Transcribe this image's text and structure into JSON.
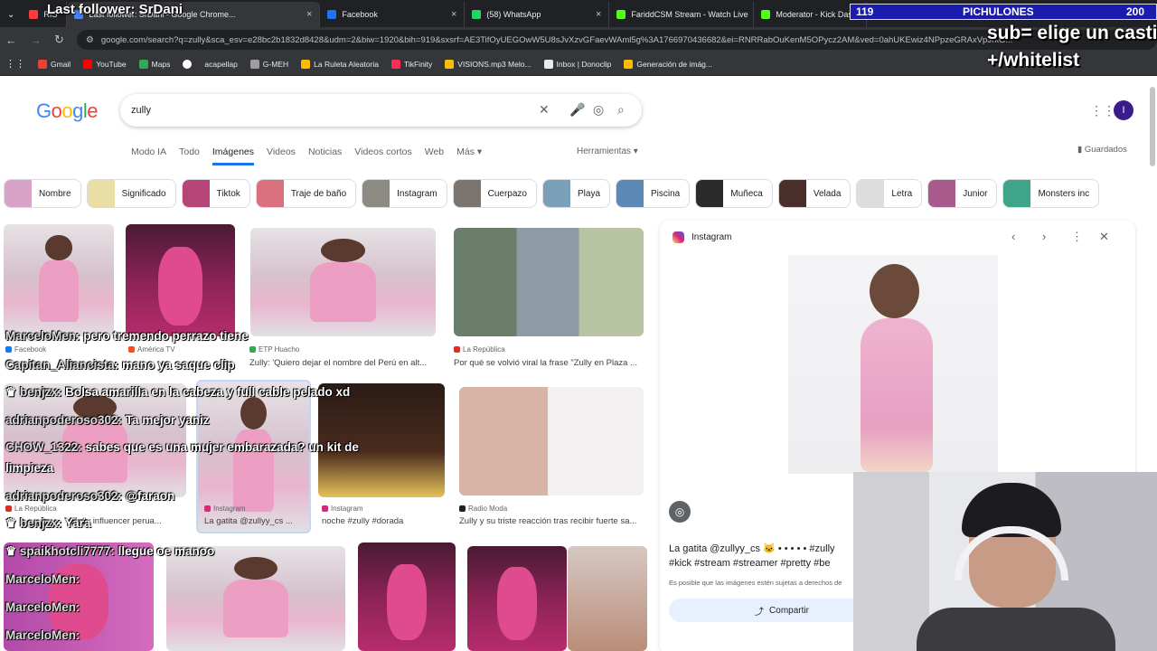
{
  "browser": {
    "tabs": [
      {
        "label": "RIS",
        "color": "#ff3b3b"
      },
      {
        "label": "Last follower: SrDani - Google Chrome...",
        "color": "#4285f4"
      },
      {
        "label": "Facebook",
        "color": "#1877f2"
      },
      {
        "label": "(58) WhatsApp",
        "color": "#25d366"
      },
      {
        "label": "FariddCSM Stream - Watch Live",
        "color": "#53fc18"
      },
      {
        "label": "Moderator - Kick Dashboard",
        "color": "#53fc18"
      }
    ],
    "url": "google.com/search?q=zully&sca_esv=e28bc2b1832d8428&udm=2&biw=1920&bih=919&sxsrf=AE3TifOyUEGOwW5U8sJvXzvGFaevWAml5g%3A1766970436682&ei=RNRRabOuKenM5OPycz2AM&ved=0ahUKEwiz4NPpzeGRAxVpJrkG...",
    "bookmarks": [
      {
        "label": "Gmail",
        "color": "#ea4335"
      },
      {
        "label": "YouTube",
        "color": "#ff0000"
      },
      {
        "label": "Maps",
        "color": "#34a853"
      },
      {
        "label": "",
        "color": "#ffffff"
      },
      {
        "label": "acapellap",
        "color": "#9e9e9e"
      },
      {
        "label": "G-MEH",
        "color": "#9e9e9e"
      },
      {
        "label": "La Ruleta Aleatoria",
        "color": "#fbbc05"
      },
      {
        "label": "TikFinity",
        "color": "#ff2d55"
      },
      {
        "label": "VISIONS.mp3 Melo...",
        "color": "#fbbc05"
      },
      {
        "label": "Inbox | Donoclip",
        "color": "#e8eaed"
      },
      {
        "label": "Generación de imág...",
        "color": "#fbbc05"
      }
    ]
  },
  "google": {
    "logo": "Google",
    "query": "zully",
    "avatar_letter": "I",
    "nav": [
      "Modo IA",
      "Todo",
      "Imágenes",
      "Videos",
      "Noticias",
      "Videos cortos",
      "Web",
      "Más ▾"
    ],
    "tools": "Herramientas ▾",
    "saved": "Guardados",
    "chips": [
      {
        "label": "Nombre",
        "color": "#d8a3c6"
      },
      {
        "label": "Significado",
        "color": "#e9dfa6"
      },
      {
        "label": "Tiktok",
        "color": "#b54577"
      },
      {
        "label": "Traje de baño",
        "color": "#d9707e"
      },
      {
        "label": "Instagram",
        "color": "#8c8a83"
      },
      {
        "label": "Cuerpazo",
        "color": "#7c746e"
      },
      {
        "label": "Playa",
        "color": "#7aa0b8"
      },
      {
        "label": "Piscina",
        "color": "#5b88b5"
      },
      {
        "label": "Muñeca",
        "color": "#2b2b2b"
      },
      {
        "label": "Velada",
        "color": "#4a2e2a"
      },
      {
        "label": "Letra",
        "color": "#dddddd"
      },
      {
        "label": "Junior",
        "color": "#a85a8c"
      },
      {
        "label": "Monsters inc",
        "color": "#3fa58a"
      }
    ],
    "results": [
      {
        "source": "Facebook",
        "caption": "",
        "color": "#1877f2"
      },
      {
        "source": "América TV",
        "caption": "",
        "color": "#f4511e"
      },
      {
        "source": "ETP Huacho",
        "caption": "Zully: 'Quiero dejar el nombre del Perú en alt...",
        "color": "#34a853"
      },
      {
        "source": "La República",
        "caption": "Por qué se volvió viral la frase \"Zully en Plaza ...",
        "color": "#d93025"
      },
      {
        "source": "La República",
        "caption": "Zully influencer perua...",
        "color": "#d93025"
      },
      {
        "source": "Instagram",
        "caption": "La gatita @zullyy_cs ...",
        "color": "#d62976"
      },
      {
        "source": "Instagram",
        "caption": "noche #zully #dorada",
        "color": "#d62976"
      },
      {
        "source": "Radio Moda",
        "caption": "Zully y su triste reacción tras recibir fuerte sa...",
        "color": "#202124"
      }
    ]
  },
  "panel": {
    "source": "Instagram",
    "title": "La gatita @zullyy_cs 🐱 • • • • • #zully",
    "tags": "#kick #stream #streamer #pretty #be",
    "note": "Es posible que las imágenes estén sujetas a derechos de",
    "share": "Compartir"
  },
  "overlay": {
    "last_follower": "Last follower: SrDani",
    "counter_left": "119",
    "counter_title": "PICHULONES",
    "counter_right": "200",
    "sub_line1": "sub= elige un castigo",
    "sub_line2": "+/whitelist",
    "chat": [
      {
        "user": "MarceloMen:",
        "msg": "pero tremendo perrazo tiene"
      },
      {
        "user": "Capitan_Aliancista:",
        "msg": "mano ya saque clip"
      },
      {
        "user": "benjzx:",
        "msg": "Bolsa amarilla en la cabeza y full cable pelado xd"
      },
      {
        "user": "adrianpoderoso302:",
        "msg": "Ta mejor yaniz"
      },
      {
        "user": "CHOW_1322:",
        "msg": "sabes que es una mujer embarazada? un kit de"
      },
      {
        "user": "",
        "msg": "limpieza"
      },
      {
        "user": "adrianpoderoso302:",
        "msg": "@faraon"
      },
      {
        "user": "benjzx:",
        "msg": "Yara"
      },
      {
        "user": "spaikhotcli7777:",
        "msg": "llegue oe manoo"
      },
      {
        "user": "MarceloMen:",
        "msg": ""
      },
      {
        "user": "MarceloMen:",
        "msg": ""
      },
      {
        "user": "MarceloMen:",
        "msg": ""
      }
    ]
  }
}
